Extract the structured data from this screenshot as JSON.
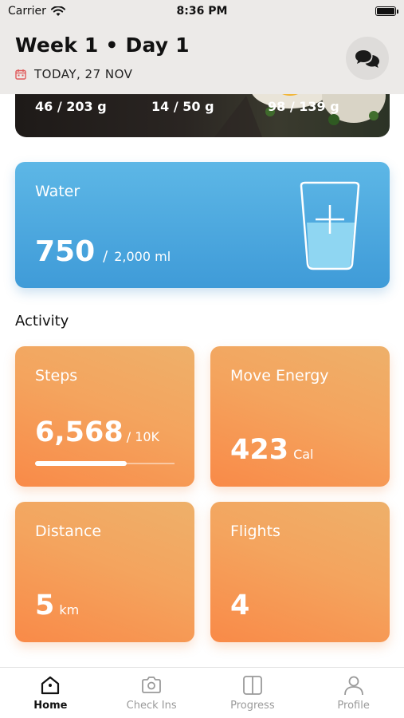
{
  "status_bar": {
    "carrier": "Carrier",
    "time": "8:36 PM"
  },
  "header": {
    "title": "Week 1 • Day 1",
    "date": "TODAY, 27 NOV",
    "accent_color": "#e05a5a"
  },
  "macros": {
    "items": [
      {
        "value": "46 / 203 g"
      },
      {
        "value": "14 / 50 g"
      },
      {
        "value": "98 / 139 g"
      }
    ]
  },
  "water": {
    "label": "Water",
    "current": "750",
    "separator": "/",
    "goal": "2,000 ml",
    "fill_fraction": 0.375,
    "color": "#4aa8de"
  },
  "activity": {
    "title": "Activity",
    "steps": {
      "label": "Steps",
      "value": "6,568",
      "goal": "/ 10K",
      "progress": 0.6568
    },
    "move_energy": {
      "label": "Move Energy",
      "value": "423",
      "unit": "Cal"
    },
    "distance": {
      "label": "Distance",
      "value": "5",
      "unit": "km"
    },
    "flights": {
      "label": "Flights",
      "value": "4"
    },
    "tile_color": "#f4995a"
  },
  "tabs": [
    {
      "label": "Home",
      "icon": "home-icon",
      "active": true
    },
    {
      "label": "Check Ins",
      "icon": "camera-icon",
      "active": false
    },
    {
      "label": "Progress",
      "icon": "book-icon",
      "active": false
    },
    {
      "label": "Profile",
      "icon": "person-icon",
      "active": false
    }
  ]
}
